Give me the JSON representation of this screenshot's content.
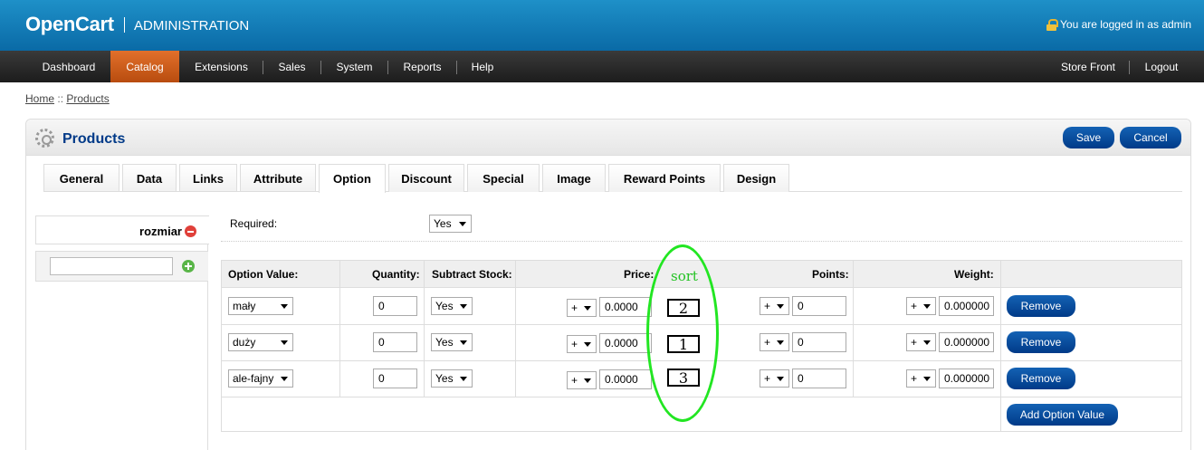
{
  "header": {
    "logo": "OpenCart",
    "section": "ADMINISTRATION",
    "logged_in": "You are logged in as admin"
  },
  "menu": {
    "left": [
      "Dashboard",
      "Catalog",
      "Extensions",
      "Sales",
      "System",
      "Reports",
      "Help"
    ],
    "active": "Catalog",
    "right": [
      "Store Front",
      "Logout"
    ]
  },
  "breadcrumb": {
    "home": "Home",
    "separator": "::",
    "current": "Products"
  },
  "box": {
    "title": "Products",
    "save_label": "Save",
    "cancel_label": "Cancel"
  },
  "tabs": [
    "General",
    "Data",
    "Links",
    "Attribute",
    "Option",
    "Discount",
    "Special",
    "Image",
    "Reward Points",
    "Design"
  ],
  "active_tab": "Option",
  "option_list": {
    "items": [
      "rozmiar"
    ],
    "new_option_value": ""
  },
  "required": {
    "label": "Required:",
    "value": "Yes"
  },
  "table": {
    "headers": {
      "option_value": "Option Value:",
      "quantity": "Quantity:",
      "subtract": "Subtract Stock:",
      "price": "Price:",
      "points": "Points:",
      "weight": "Weight:"
    },
    "rows": [
      {
        "option_value": "mały",
        "quantity": "0",
        "subtract": "Yes",
        "price_prefix": "+",
        "price": "0.0000",
        "sort": "2",
        "points_prefix": "+",
        "points": "0",
        "weight_prefix": "+",
        "weight": "0.000000",
        "remove": "Remove"
      },
      {
        "option_value": "duży",
        "quantity": "0",
        "subtract": "Yes",
        "price_prefix": "+",
        "price": "0.0000",
        "sort": "1",
        "points_prefix": "+",
        "points": "0",
        "weight_prefix": "+",
        "weight": "0.000000",
        "remove": "Remove"
      },
      {
        "option_value": "ale-fajny",
        "quantity": "0",
        "subtract": "Yes",
        "price_prefix": "+",
        "price": "0.0000",
        "sort": "3",
        "points_prefix": "+",
        "points": "0",
        "weight_prefix": "+",
        "weight": "0.000000",
        "remove": "Remove"
      }
    ],
    "add_option_value": "Add Option Value"
  },
  "annotation": {
    "label": "sort",
    "color": "#22e622"
  }
}
